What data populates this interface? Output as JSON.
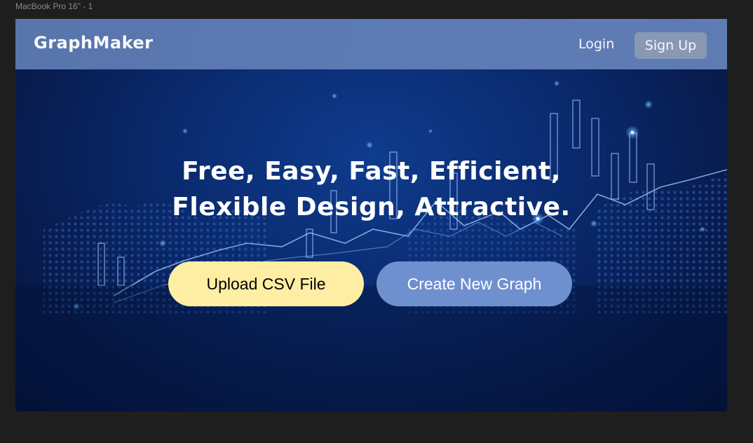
{
  "frame": {
    "label": "MacBook Pro 16\" - 1"
  },
  "nav": {
    "brand": "GraphMaker",
    "login_label": "Login",
    "signup_label": "Sign Up"
  },
  "hero": {
    "line1": "Free, Easy, Fast, Efficient,",
    "line2": "Flexible Design, Attractive.",
    "upload_label": "Upload CSV File",
    "create_label": "Create New Graph"
  },
  "colors": {
    "page_bg": "#1e1e1e",
    "navbar": "#5f7cb6",
    "signup_button": "#8c9db8",
    "upload_button": "#fdeea3",
    "create_button": "#6f90cf",
    "hero_background": "#0a2a6e"
  }
}
